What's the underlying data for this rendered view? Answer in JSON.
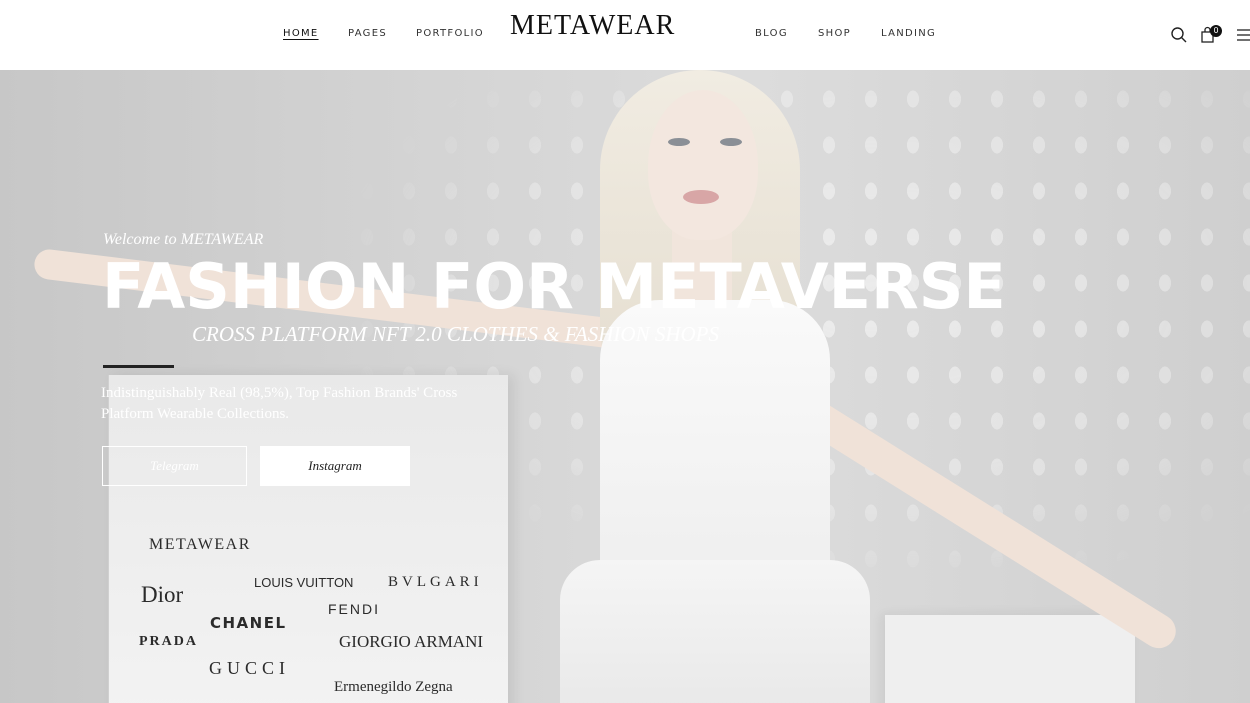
{
  "header": {
    "logo": "METAWEAR",
    "nav_left": [
      "HOME",
      "PAGES",
      "PORTFOLIO"
    ],
    "nav_right": [
      "BLOG",
      "SHOP",
      "LANDING"
    ],
    "cart_count": "0",
    "icons": [
      "search-icon",
      "cart-icon",
      "menu-icon"
    ]
  },
  "hero": {
    "welcome": "Welcome to METAWEAR",
    "headline": "FASHION FOR METAVERSE",
    "subheadline": "CROSS PLATFORM NFT 2.0 CLOTHES & FASHION SHOPS",
    "description": "Indistinguishably Real (98,5%), Top Fashion Brands' Cross Platform Wearable Collections.",
    "buttons": {
      "telegram": "Telegram",
      "instagram": "Instagram"
    }
  },
  "brands": {
    "metawear": "METAWEAR",
    "dior": "Dior",
    "louis_vuitton": "LOUIS VUITTON",
    "bvlgari": "BVLGARI",
    "fendi": "FENDI",
    "chanel": "CHANEL",
    "prada": "PRADA",
    "giorgio_armani": "GIORGIO ARMANI",
    "gucci": "GUCCI",
    "zegna": "Ermenegildo Zegna"
  },
  "colors": {
    "text_dark": "#111111",
    "hero_bg": "#d4d4d4",
    "white": "#ffffff"
  }
}
